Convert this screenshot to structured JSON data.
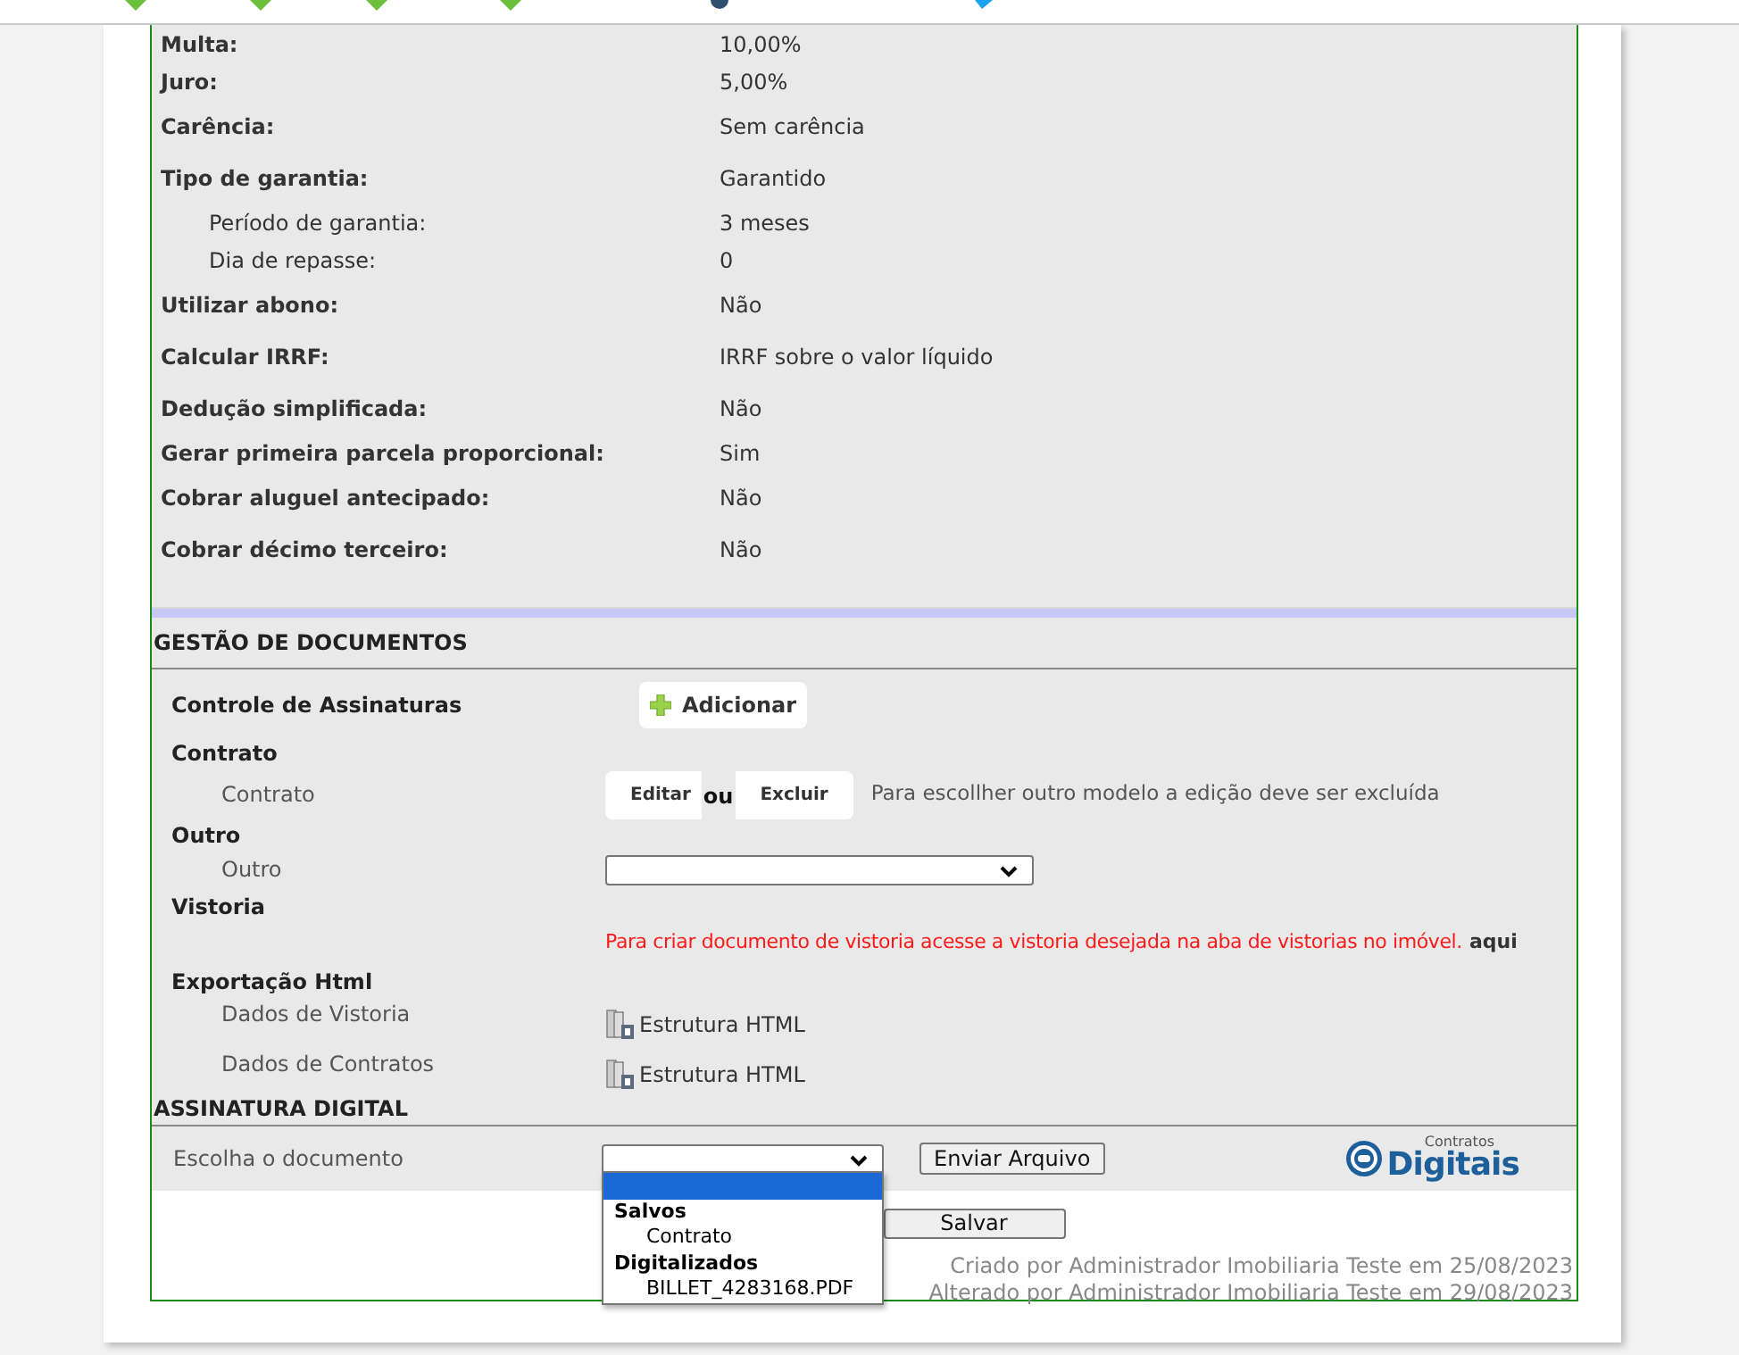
{
  "details": [
    {
      "label": "Multa:",
      "value": "10,00%",
      "indented": false
    },
    {
      "label": "Juro:",
      "value": "5,00%",
      "indented": false
    },
    {
      "label": "Carência:",
      "value": "Sem carência",
      "indented": false
    },
    {
      "label": "Tipo de garantia:",
      "value": "Garantido",
      "indented": false
    },
    {
      "label": "Período de garantia:",
      "value": "3 meses",
      "indented": true
    },
    {
      "label": "Dia de repasse:",
      "value": "0",
      "indented": true
    },
    {
      "label": "Utilizar abono:",
      "value": "Não",
      "indented": false
    },
    {
      "label": "Calcular IRRF:",
      "value": "IRRF sobre o valor líquido",
      "indented": false
    },
    {
      "label": "Dedução simplificada:",
      "value": "Não",
      "indented": false
    },
    {
      "label": "Gerar primeira parcela proporcional:",
      "value": "Sim",
      "indented": false
    },
    {
      "label": "Cobrar aluguel antecipado:",
      "value": "Não",
      "indented": false
    },
    {
      "label": "Cobrar décimo terceiro:",
      "value": "Não",
      "indented": false
    }
  ],
  "documents": {
    "title": "GESTÃO DE DOCUMENTOS",
    "signatures": {
      "label": "Controle de Assinaturas",
      "button": "Adicionar"
    },
    "contract": {
      "heading": "Contrato",
      "label": "Contrato",
      "edit": "Editar",
      "separator": "ou",
      "delete": "Excluir",
      "note": "Para escollher outro modelo a edição deve ser excluída"
    },
    "other": {
      "heading": "Outro",
      "label": "Outro"
    },
    "inspection": {
      "heading": "Vistoria",
      "message": "Para criar documento de vistoria acesse a vistoria desejada na aba de vistorias no imóvel.",
      "link": "aqui"
    },
    "export": {
      "heading": "Exportação Html",
      "items": [
        {
          "label": "Dados de Vistoria",
          "link": "Estrutura HTML"
        },
        {
          "label": "Dados de Contratos",
          "link": "Estrutura HTML"
        }
      ]
    }
  },
  "digital_signature": {
    "title": "ASSINATURA DIGITAL",
    "label": "Escolha o documento",
    "button": "Enviar Arquivo",
    "logo_small": "Contratos",
    "logo_big": "Digitais",
    "options": [
      {
        "kind": "option",
        "selected": true
      },
      {
        "kind": "group",
        "label": "Salvos",
        "selected": false
      },
      {
        "kind": "option",
        "label": "Contrato",
        "selected": false
      },
      {
        "kind": "group",
        "label": "Digitalizados",
        "selected": false
      },
      {
        "kind": "option",
        "label": "BILLET_4283168.PDF",
        "selected": false
      }
    ]
  },
  "save_button": "Salvar",
  "footer": [
    "Criado por Administrador Imobiliaria Teste em 25/08/2023",
    "Alterado por Administrador Imobiliaria Teste em 29/08/2023"
  ]
}
